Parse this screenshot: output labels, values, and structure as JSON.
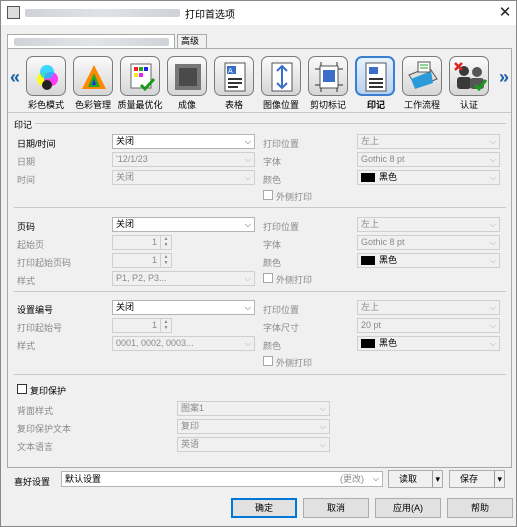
{
  "window": {
    "title": "打印首选项",
    "close_icon": "close-icon"
  },
  "tabs": {
    "advanced": "高级"
  },
  "toolbar": {
    "items": [
      {
        "label": "彩色模式",
        "icon": "color-mode-icon"
      },
      {
        "label": "色彩管理",
        "icon": "color-management-icon"
      },
      {
        "label": "质量最优化",
        "icon": "quality-optimize-icon"
      },
      {
        "label": "成像",
        "icon": "imaging-icon"
      },
      {
        "label": "表格",
        "icon": "form-icon"
      },
      {
        "label": "图像位置",
        "icon": "image-position-icon"
      },
      {
        "label": "剪切标记",
        "icon": "crop-marks-icon"
      },
      {
        "label": "印记",
        "icon": "stamp-icon"
      },
      {
        "label": "工作流程",
        "icon": "workflow-icon"
      },
      {
        "label": "认证",
        "icon": "authentication-icon"
      }
    ],
    "selected": "印记",
    "left_arrow": "«",
    "right_arrow": "»"
  },
  "stamp": {
    "group_label": "印记",
    "datetime": {
      "label": "日期/时间",
      "value": "关闭",
      "date_label": "日期",
      "date_value": "'12/1/23",
      "time_label": "时间",
      "time_value": "关闭",
      "pos_label": "打印位置",
      "pos_value": "左上",
      "font_label": "字体",
      "font_value": "Gothic 8 pt",
      "color_label": "颜色",
      "color_value": "黑色",
      "outside_label": "外侧打印"
    },
    "pagenum": {
      "label": "页码",
      "value": "关闭",
      "start_label": "起始页",
      "start_value": "1",
      "startpage_label": "打印起始页码",
      "startpage_value": "1",
      "style_label": "样式",
      "style_value": "P1, P2, P3...",
      "pos_label": "打印位置",
      "pos_value": "左上",
      "font_label": "字体",
      "font_value": "Gothic 8 pt",
      "color_label": "颜色",
      "color_value": "黑色",
      "outside_label": "外侧打印"
    },
    "setnum": {
      "label": "设置编号",
      "value": "关闭",
      "start_label": "打印起始号",
      "start_value": "1",
      "style_label": "样式",
      "style_value": "0001, 0002, 0003...",
      "pos_label": "打印位置",
      "pos_value": "左上",
      "size_label": "字体尺寸",
      "size_value": "20 pt",
      "color_label": "颜色",
      "color_value": "黑色",
      "outside_label": "外侧打印"
    },
    "copyprotect": {
      "label": "复印保护",
      "bg_label": "背面样式",
      "bg_value": "图案1",
      "text_label": "复印保护文本",
      "text_value": "复印",
      "lang_label": "文本语言",
      "lang_value": "英语"
    }
  },
  "favorites": {
    "label": "喜好设置",
    "value": "默认设置",
    "changed": "(更改)",
    "read": "读取",
    "save": "保存"
  },
  "footer": {
    "ok": "确定",
    "cancel": "取消",
    "apply": "应用(A)",
    "help": "帮助"
  }
}
